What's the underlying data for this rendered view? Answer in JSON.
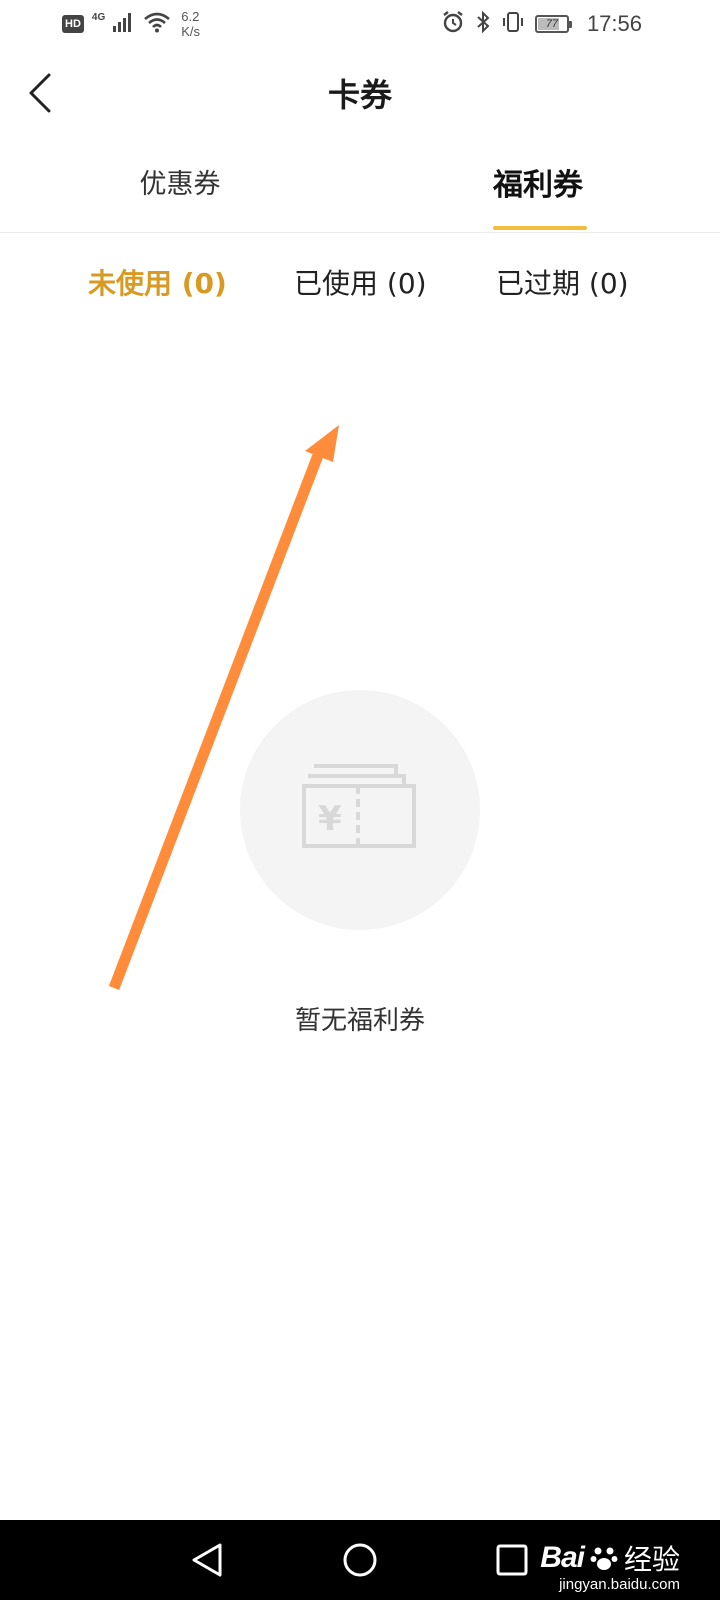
{
  "status_bar": {
    "hd_label": "HD",
    "network_label": "4G",
    "speed_value": "6.2",
    "speed_unit": "K/s",
    "battery_level": "77",
    "battery_fraction": 0.77,
    "time": "17:56",
    "icons": [
      "signal-icon",
      "wifi-icon",
      "alarm-icon",
      "bluetooth-icon",
      "vibrate-icon",
      "battery-icon"
    ]
  },
  "header": {
    "title": "卡券",
    "back_icon": "chevron-left-icon"
  },
  "main_tabs": [
    {
      "label": "优惠券",
      "active": false
    },
    {
      "label": "福利券",
      "active": true
    }
  ],
  "sub_filters": [
    {
      "label": "未使用 (0)",
      "active": true
    },
    {
      "label": "已使用 (0)",
      "active": false
    },
    {
      "label": "已过期 (0)",
      "active": false
    }
  ],
  "empty_state": {
    "icon": "coupon-yuan-icon",
    "icon_symbol": "¥",
    "message": "暂无福利券"
  },
  "nav_bar": {
    "icons": [
      "nav-back-icon",
      "nav-home-icon",
      "nav-recent-icon"
    ]
  },
  "watermark": {
    "brand": "Bai",
    "brand_suffix": "经验",
    "url": "jingyan.baidu.com"
  },
  "colors": {
    "accent": "#d79a22",
    "tab_indicator": "#f2bd3c",
    "annotation_arrow": "#ff8c3a",
    "empty_circle": "#f4f4f4",
    "empty_icon": "#d8d8d8",
    "nav_bar": "#000000"
  }
}
